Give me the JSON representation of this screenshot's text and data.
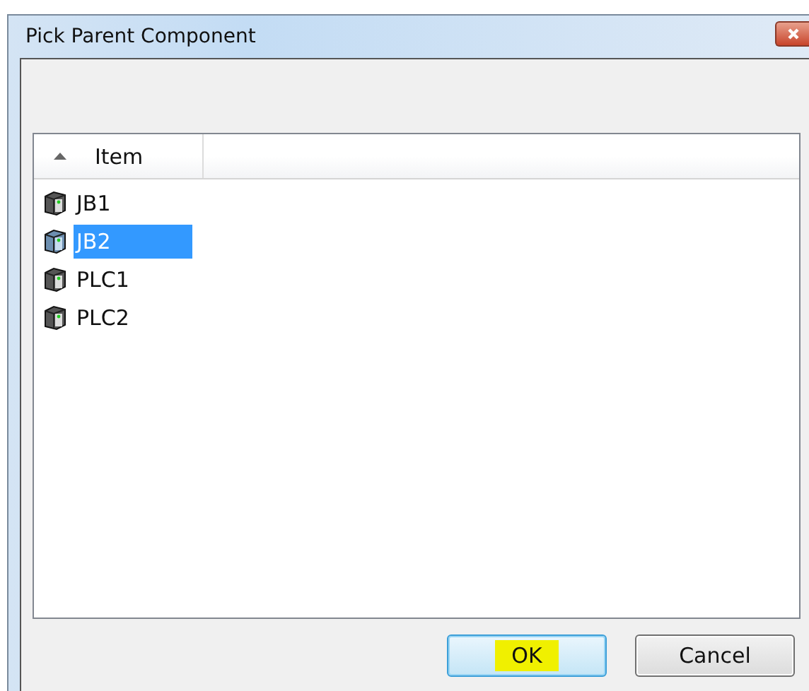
{
  "window": {
    "title": "Pick Parent Component"
  },
  "list": {
    "columns": [
      {
        "label": "Item",
        "sorted": true
      }
    ],
    "items": [
      {
        "label": "JB1",
        "selected": false
      },
      {
        "label": "JB2",
        "selected": true
      },
      {
        "label": "PLC1",
        "selected": false
      },
      {
        "label": "PLC2",
        "selected": false
      }
    ]
  },
  "buttons": [
    {
      "label": "OK",
      "default": true,
      "highlighted": true
    },
    {
      "label": "Cancel",
      "default": false,
      "highlighted": false
    }
  ]
}
